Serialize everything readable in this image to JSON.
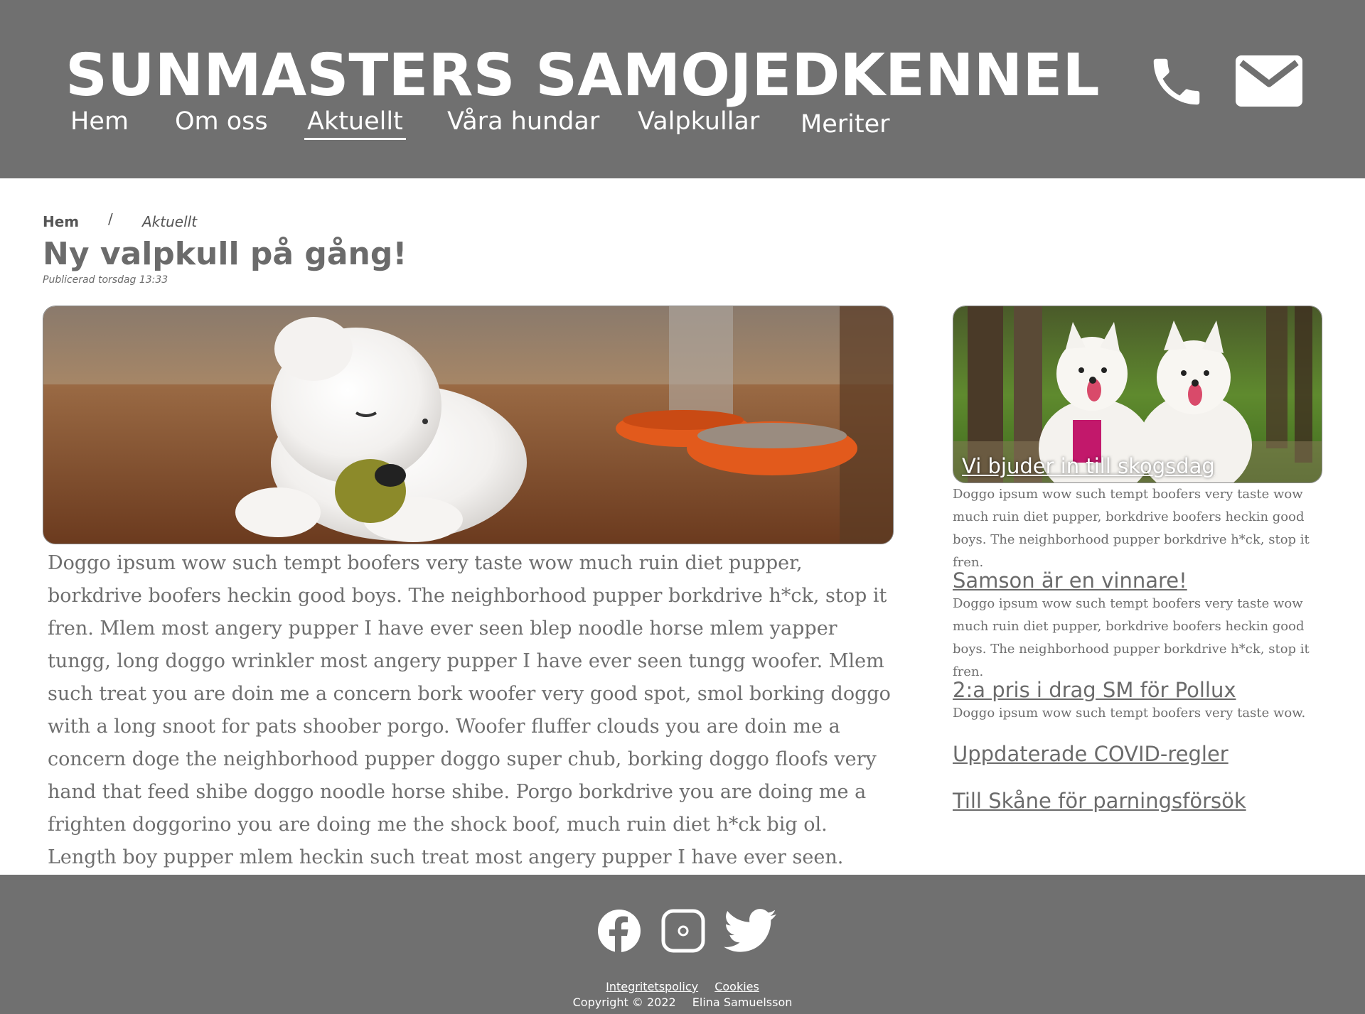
{
  "header": {
    "logo": "SUNMASTERS SAMOJEDKENNEL",
    "nav": [
      {
        "label": "Hem"
      },
      {
        "label": "Om oss"
      },
      {
        "label": "Aktuellt"
      },
      {
        "label": "Våra hundar"
      },
      {
        "label": "Valpkullar"
      },
      {
        "label": "Meriter"
      }
    ],
    "active_nav": "Aktuellt",
    "icons": [
      "phone-icon",
      "mail-icon"
    ]
  },
  "breadcrumb": {
    "home": "Hem",
    "separator": "/",
    "current": "Aktuellt"
  },
  "article": {
    "title": "Ny valpkull på gång!",
    "published": "Publicerad torsdag 13:33",
    "image_alt": "white-puppy-image",
    "body": "Doggo ipsum wow such tempt boofers very taste wow much ruin diet pupper, borkdrive boofers heckin good boys. The neighborhood pupper borkdrive h*ck, stop it fren. Mlem most angery pupper I have ever seen blep noodle horse mlem yapper tungg, long doggo wrinkler most angery pupper I have ever seen tungg woofer. Mlem such treat you are doin me a concern bork woofer very good spot, smol borking doggo with a long snoot for pats shoober porgo. Woofer fluffer clouds you are doin me a concern doge the neighborhood pupper doggo super chub, borking doggo floofs very hand that feed shibe doggo noodle horse shibe. Porgo borkdrive you are doing me a frighten doggorino you are doing me the shock boof, much ruin diet h*ck big ol. Length boy pupper mlem heckin such treat most angery pupper I have ever seen."
  },
  "sidebar": {
    "featured": {
      "caption": "Vi bjuder in till skogsdag",
      "text": "Doggo ipsum wow such tempt boofers very taste wow much ruin diet pupper, borkdrive boofers heckin good boys. The neighborhood pupper borkdrive h*ck, stop it fren."
    },
    "items": [
      {
        "title": "Samson är en vinnare!",
        "text": "Doggo ipsum wow such tempt boofers very taste wow much ruin diet pupper, borkdrive boofers heckin good boys. The neighborhood pupper borkdrive h*ck, stop it fren."
      },
      {
        "title": "2:a pris i drag SM för Pollux",
        "text": "Doggo ipsum wow such tempt boofers very taste wow."
      },
      {
        "title": "Uppdaterade COVID-regler"
      },
      {
        "title": "Till Skåne för parningsförsök"
      }
    ]
  },
  "footer": {
    "social": [
      "facebook-icon",
      "instagram-icon",
      "twitter-icon"
    ],
    "links": [
      "Integritetspolicy",
      "Cookies"
    ],
    "copyright": "Copyright © 2022",
    "author": "Elina Samuelsson"
  },
  "colors": {
    "header_bg": "#707070",
    "footer_bg": "#707070",
    "text": "#6b6b6b",
    "white": "#ffffff"
  }
}
